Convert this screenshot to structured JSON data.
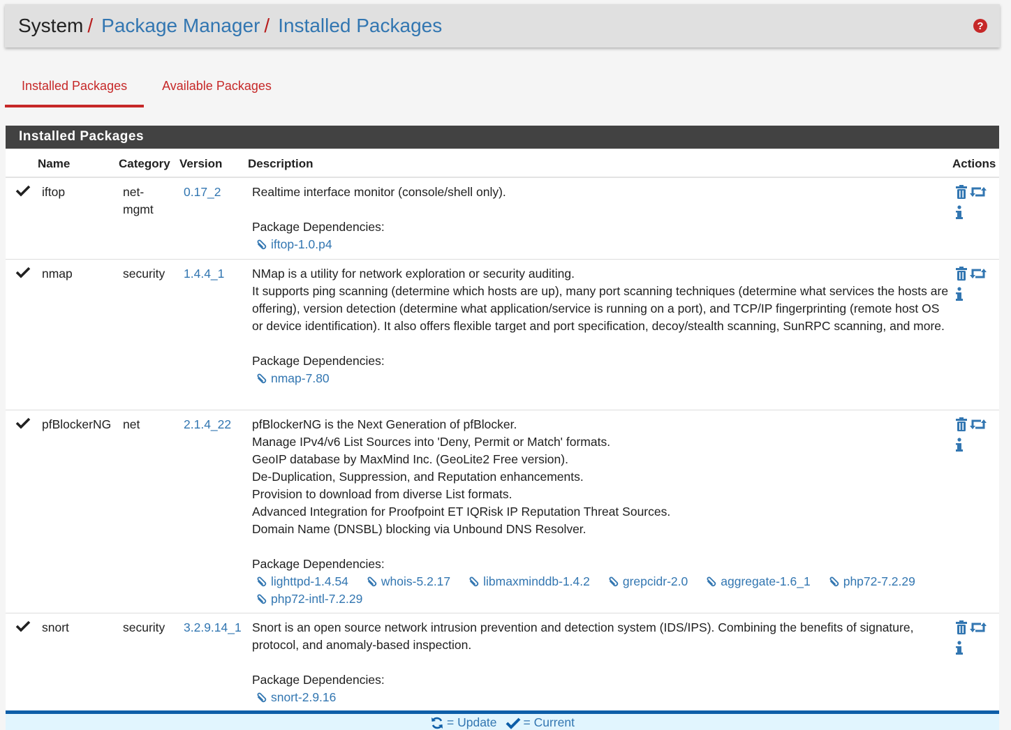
{
  "breadcrumb": {
    "items": [
      {
        "label": "System",
        "link": false
      },
      {
        "label": "Package Manager",
        "link": true
      },
      {
        "label": "Installed Packages",
        "link": true
      }
    ],
    "separator": "/"
  },
  "help_icon": "question-circle-icon",
  "tabs": [
    {
      "label": "Installed Packages",
      "active": true
    },
    {
      "label": "Available Packages",
      "active": false
    }
  ],
  "panel": {
    "title": "Installed Packages",
    "columns": {
      "name": "Name",
      "category": "Category",
      "version": "Version",
      "description": "Description",
      "actions": "Actions"
    },
    "deps_label": "Package Dependencies:",
    "packages": [
      {
        "name": "iftop",
        "category": "net-mgmt",
        "version": "0.17_2",
        "description": [
          "Realtime interface monitor (console/shell only)."
        ],
        "dependencies": [
          "iftop-1.0.p4"
        ]
      },
      {
        "name": "nmap",
        "category": "security",
        "version": "1.4.4_1",
        "description": [
          "NMap is a utility for network exploration or security auditing.",
          "It supports ping scanning (determine which hosts are up), many port scanning techniques (determine what services the hosts are offering), version detection (determine what application/service is running on a port), and TCP/IP fingerprinting (remote host OS or device identification). It also offers flexible target and port specification, decoy/stealth scanning, SunRPC scanning, and more."
        ],
        "dependencies": [
          "nmap-7.80"
        ]
      },
      {
        "name": "pfBlockerNG",
        "category": "net",
        "version": "2.1.4_22",
        "description": [
          "pfBlockerNG is the Next Generation of pfBlocker.",
          "Manage IPv4/v6 List Sources into 'Deny, Permit or Match' formats.",
          "GeoIP database by MaxMind Inc. (GeoLite2 Free version).",
          "De-Duplication, Suppression, and Reputation enhancements.",
          "Provision to download from diverse List formats.",
          "Advanced Integration for Proofpoint ET IQRisk IP Reputation Threat Sources.",
          "Domain Name (DNSBL) blocking via Unbound DNS Resolver."
        ],
        "dependencies": [
          "lighttpd-1.4.54",
          "whois-5.2.17",
          "libmaxminddb-1.4.2",
          "grepcidr-2.0",
          "aggregate-1.6_1",
          "php72-7.2.29",
          "php72-intl-7.2.29"
        ]
      },
      {
        "name": "snort",
        "category": "security",
        "version": "3.2.9.14_1",
        "description": [
          "Snort is an open source network intrusion prevention and detection system (IDS/IPS). Combining the benefits of signature, protocol, and anomaly-based inspection."
        ],
        "dependencies": [
          "snort-2.9.16"
        ]
      }
    ]
  },
  "legend": {
    "update": "= Update",
    "current": "= Current"
  },
  "colors": {
    "accent_red": "#c62828",
    "link_blue": "#3276b1",
    "panel_heading": "#424242",
    "legend_bg": "#e1f5fe"
  }
}
